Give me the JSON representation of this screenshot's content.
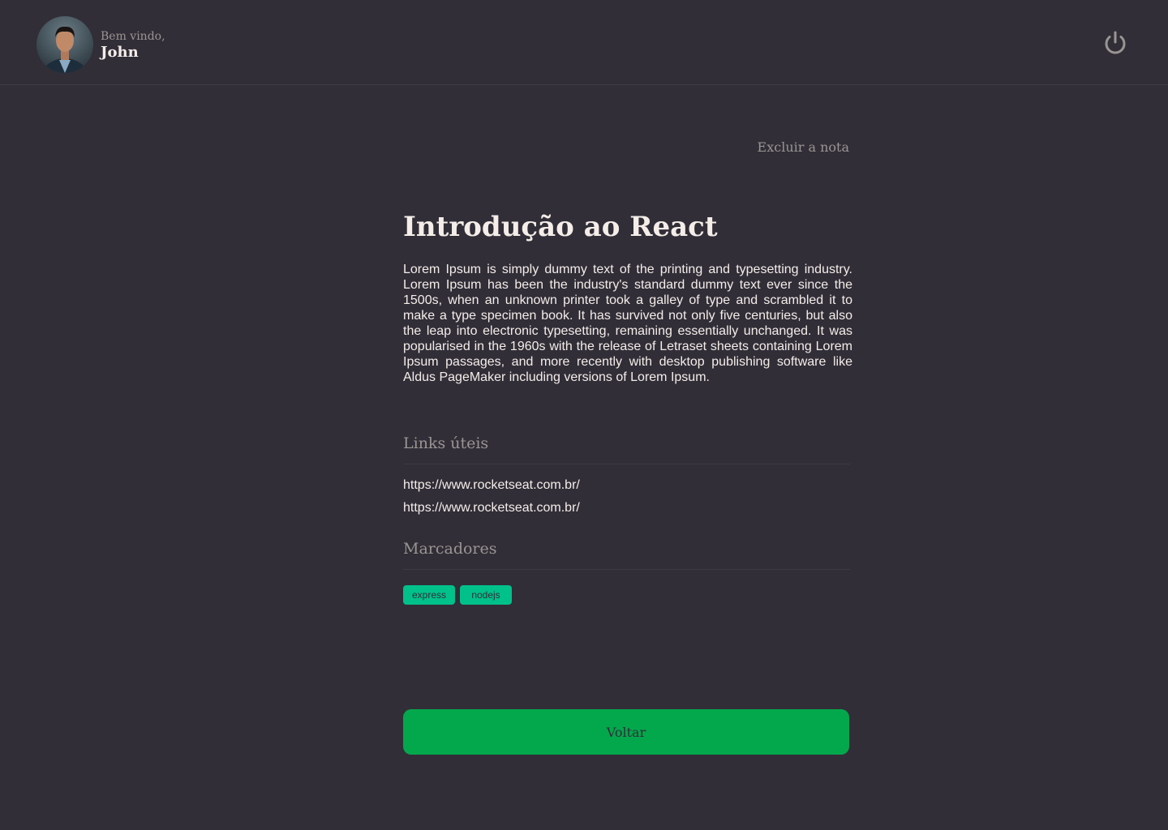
{
  "header": {
    "greeting": "Bem vindo,",
    "user_name": "John",
    "avatar_icon": "user-avatar",
    "signout_icon": "power-icon"
  },
  "note": {
    "delete_label": "Excluir a nota",
    "title": "Introdução ao React",
    "description": "Lorem Ipsum is simply dummy text of the printing and typesetting industry. Lorem Ipsum has been the industry's standard dummy text ever since the 1500s, when an unknown printer took a galley of type and scrambled it to make a type specimen book. It has survived not only five centuries, but also the leap into electronic typesetting, remaining essentially unchanged. It was popularised in the 1960s with the release of Letraset sheets containing Lorem Ipsum passages, and more recently with desktop publishing software like Aldus PageMaker including versions of Lorem Ipsum.",
    "links_title": "Links úteis",
    "links": [
      "https://www.rocketseat.com.br/",
      "https://www.rocketseat.com.br/"
    ],
    "tags_title": "Marcadores",
    "tags": [
      "express",
      "nodejs"
    ],
    "back_label": "Voltar"
  },
  "colors": {
    "background": "#312e38",
    "text": "#f4ede8",
    "muted": "#999591",
    "tag": "#00c18a",
    "button": "#03a84c"
  }
}
